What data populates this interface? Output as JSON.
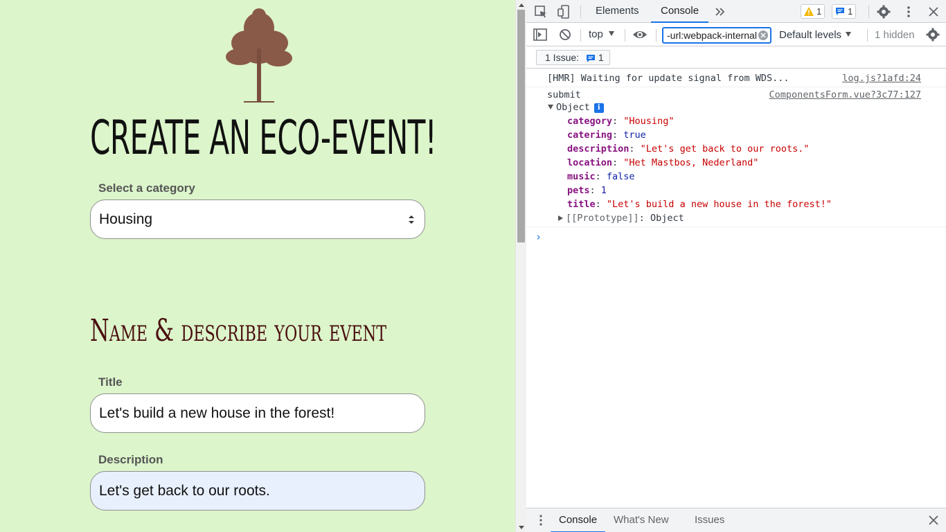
{
  "page": {
    "title": "Create an Eco-Event!",
    "category_label": "Select a category",
    "category_value": "Housing",
    "section_heading": "Name & describe your event",
    "title_label": "Title",
    "title_value": "Let's build a new house in the forest!",
    "description_label": "Description",
    "description_value": "Let's get back to our roots.",
    "colors": {
      "background": "#dcf5cb",
      "heading": "#4a0e0e",
      "autofill": "#e8f0fe"
    }
  },
  "devtools": {
    "tabs": [
      "Elements",
      "Console"
    ],
    "active_tab": "Console",
    "more_tabs_icon": "double-chevron-icon",
    "warnings_count": "1",
    "messages_count": "1",
    "toolbar": {
      "context": "top",
      "filter_value": "-url:webpack-internal",
      "levels": "Default levels",
      "hidden": "1 hidden"
    },
    "issues": {
      "label": "1 Issue:",
      "count": "1"
    },
    "console": {
      "hmr_message": "[HMR] Waiting for update signal from WDS...",
      "hmr_source": "log.js?1afd:24",
      "submit_message": "submit",
      "submit_source": "ComponentsForm.vue?3c77:127",
      "object_label": "Object",
      "properties": [
        {
          "key": "category",
          "value": "\"Housing\"",
          "type": "string"
        },
        {
          "key": "catering",
          "value": "true",
          "type": "keyword"
        },
        {
          "key": "description",
          "value": "\"Let's get back to our roots.\"",
          "type": "string"
        },
        {
          "key": "location",
          "value": "\"Het Mastbos, Nederland\"",
          "type": "string"
        },
        {
          "key": "music",
          "value": "false",
          "type": "keyword"
        },
        {
          "key": "pets",
          "value": "1",
          "type": "number"
        },
        {
          "key": "title",
          "value": "\"Let's build a new house in the forest!\"",
          "type": "string"
        }
      ],
      "prototype_key": "[[Prototype]]",
      "prototype_value": "Object"
    },
    "drawer_tabs": [
      "Console",
      "What's New",
      "Issues"
    ]
  }
}
